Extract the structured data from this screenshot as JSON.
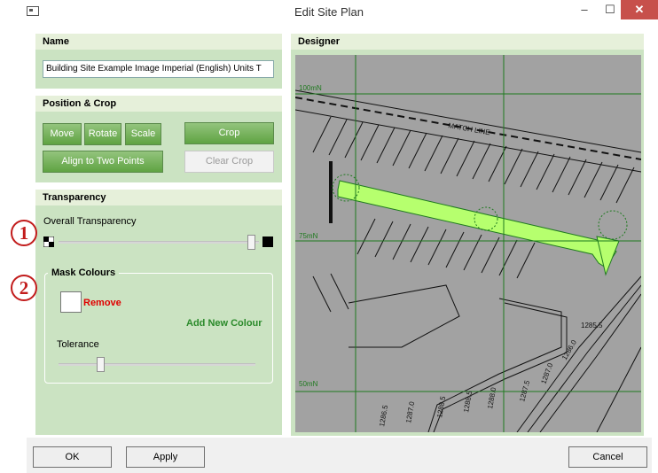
{
  "window": {
    "title": "Edit Site Plan"
  },
  "name_panel": {
    "header": "Name",
    "value": "Building Site Example Image Imperial (English) Units T"
  },
  "position_panel": {
    "header": "Position & Crop",
    "move": "Move",
    "rotate": "Rotate",
    "scale": "Scale",
    "crop": "Crop",
    "align": "Align to Two Points",
    "clear_crop": "Clear Crop"
  },
  "transparency_panel": {
    "header": "Transparency",
    "overall_label": "Overall Transparency",
    "overall_value_percent": 98,
    "mask_colours": {
      "title": "Mask Colours",
      "remove": "Remove",
      "add_new": "Add New Colour",
      "tolerance_label": "Tolerance",
      "tolerance_value_percent": 20
    }
  },
  "callouts": {
    "one": "1",
    "two": "2"
  },
  "designer": {
    "header": "Designer",
    "grid_labels": [
      "100mN",
      "75mN",
      "50mN"
    ],
    "drawing_labels": [
      "MATCH LINE",
      "1285.5",
      "1286.0",
      "1287.0",
      "1287.5",
      "1288.0",
      "1288.5",
      "1288.5",
      "1287.0",
      "1286.5"
    ]
  },
  "footer": {
    "ok": "OK",
    "apply": "Apply",
    "cancel": "Cancel"
  },
  "colors": {
    "panel_header": "#e6f0da",
    "panel_body": "#cbe3c2",
    "button_green": "#5fa342",
    "close": "#c7504b",
    "highlight": "#b6ff6e",
    "grid": "#1f7a1f",
    "callout": "#c21c1c"
  }
}
